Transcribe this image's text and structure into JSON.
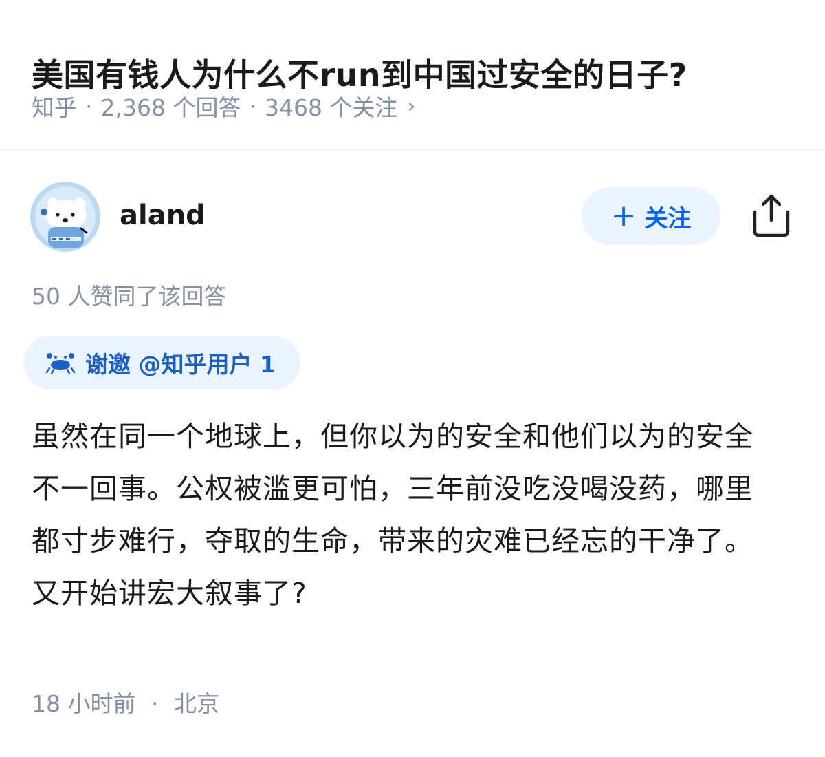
{
  "question": {
    "title": "美国有钱人为什么不run到中国过安全的日子?",
    "source": "知乎",
    "answers_count": "2,368 个回答",
    "followers_count": "3468 个关注"
  },
  "author": {
    "name": "aland",
    "follow_label": "关注"
  },
  "likes_text": "50 人赞同了该回答",
  "invite": {
    "label": "谢邀 @知乎用户 1"
  },
  "answer": {
    "text": "虽然在同一个地球上，但你以为的安全和他们以为的安全不一回事。公权被滥更可怕，三年前没吃没喝没药，哪里都寸步难行，夺取的生命，带来的灾难已经忘的干净了。又开始讲宏大叙事了?"
  },
  "footer": {
    "time": "18 小时前",
    "location": "北京"
  },
  "colors": {
    "accent": "#0066ff",
    "muted": "#8590a6",
    "chip_bg": "#ebf3ff",
    "text": "#1a1a1a"
  }
}
